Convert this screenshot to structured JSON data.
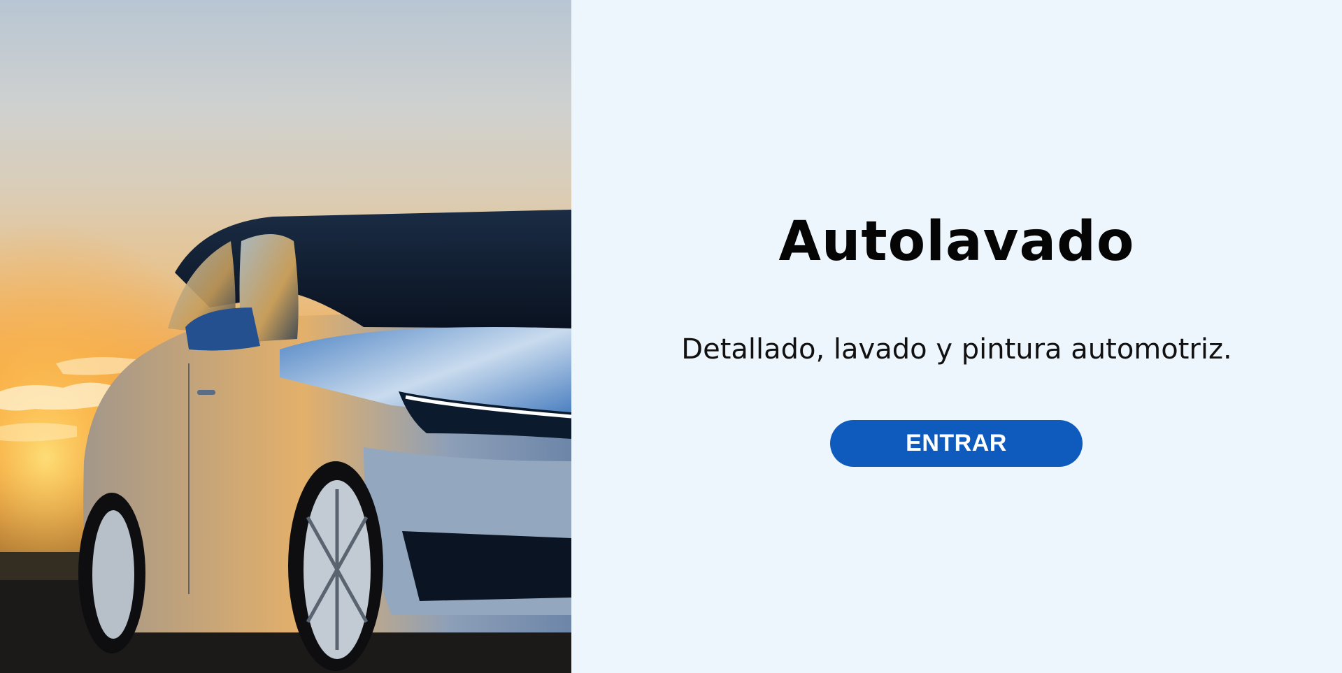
{
  "hero": {
    "image_subject": "silver electric sedan at sunset"
  },
  "main": {
    "title": "Autolavado",
    "subtitle": "Detallado, lavado y pintura automotriz.",
    "enter_button_label": "ENTRAR"
  },
  "colors": {
    "background": "#eef6fd",
    "button": "#0e5bbd",
    "button_text": "#ffffff",
    "title_text": "#050505"
  }
}
